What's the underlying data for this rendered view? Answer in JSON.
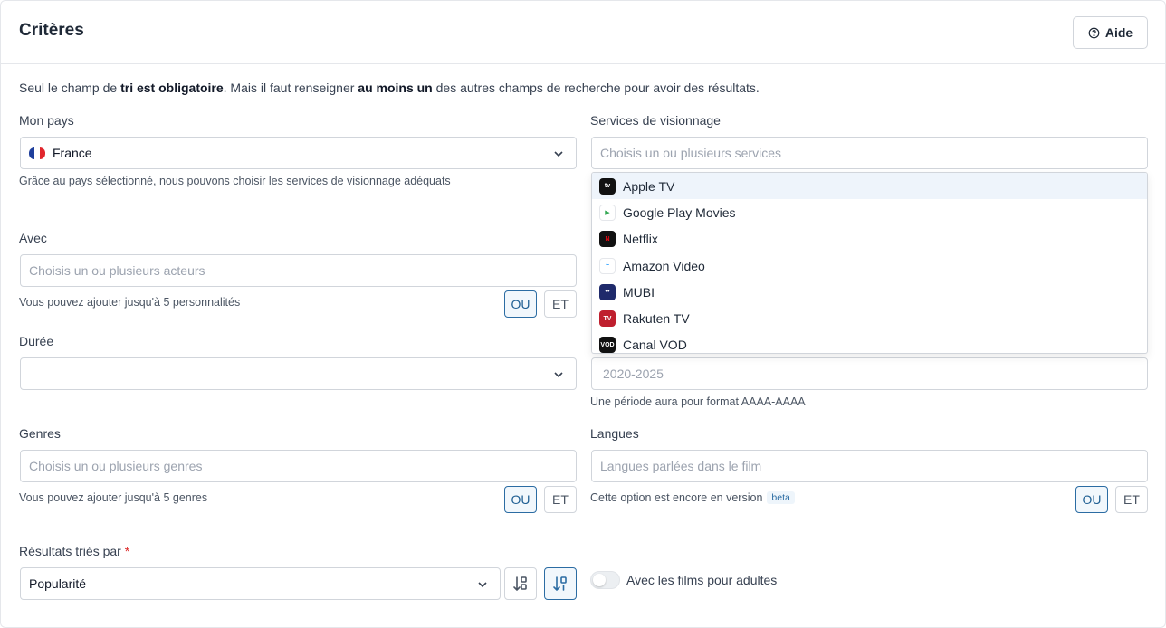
{
  "header": {
    "title": "Critères",
    "help_label": "Aide"
  },
  "intro": {
    "part1": "Seul le champ de ",
    "bold1": "tri est obligatoire",
    "part2": ". Mais il faut renseigner ",
    "bold2": "au moins un",
    "part3": " des autres champs de recherche pour avoir des résultats."
  },
  "country": {
    "label": "Mon pays",
    "value": "France",
    "hint": "Grâce au pays sélectionné, nous pouvons choisir les services de visionnage adéquats"
  },
  "services": {
    "label": "Services de visionnage",
    "placeholder": "Choisis un ou plusieurs services",
    "options": [
      {
        "label": "Apple TV",
        "icon": "apple-tv-icon",
        "color": "#111111",
        "hover": true
      },
      {
        "label": "Google Play Movies",
        "icon": "google-play-icon",
        "color": "#ffffff"
      },
      {
        "label": "Netflix",
        "icon": "netflix-icon",
        "color": "#111111"
      },
      {
        "label": "Amazon Video",
        "icon": "amazon-video-icon",
        "color": "#ffffff"
      },
      {
        "label": "MUBI",
        "icon": "mubi-icon",
        "color": "#1f2a6b"
      },
      {
        "label": "Rakuten TV",
        "icon": "rakuten-tv-icon",
        "color": "#bf1f2e"
      },
      {
        "label": "Canal VOD",
        "icon": "canal-vod-icon",
        "color": "#111111"
      }
    ]
  },
  "actors": {
    "label": "Avec",
    "placeholder": "Choisis un ou plusieurs acteurs",
    "hint": "Vous pouvez ajouter jusqu'à 5 personnalités",
    "or_label": "OU",
    "and_label": "ET"
  },
  "duration": {
    "label": "Durée",
    "value": ""
  },
  "period": {
    "placeholder": "2020-2025",
    "hint": "Une période aura pour format AAAA-AAAA"
  },
  "genres": {
    "label": "Genres",
    "placeholder": "Choisis un ou plusieurs genres",
    "hint": "Vous pouvez ajouter jusqu'à 5 genres",
    "or_label": "OU",
    "and_label": "ET"
  },
  "languages": {
    "label": "Langues",
    "placeholder": "Langues parlées dans le film",
    "hint": "Cette option est encore en version",
    "badge": "beta",
    "or_label": "OU",
    "and_label": "ET"
  },
  "sort": {
    "label": "Résultats triés par",
    "required_mark": "*",
    "value": "Popularité"
  },
  "adult": {
    "label": "Avec les films pour adultes",
    "enabled": false
  },
  "colors": {
    "accent": "#2b6ca3",
    "border": "#d1d5db",
    "required": "#dc2626"
  }
}
